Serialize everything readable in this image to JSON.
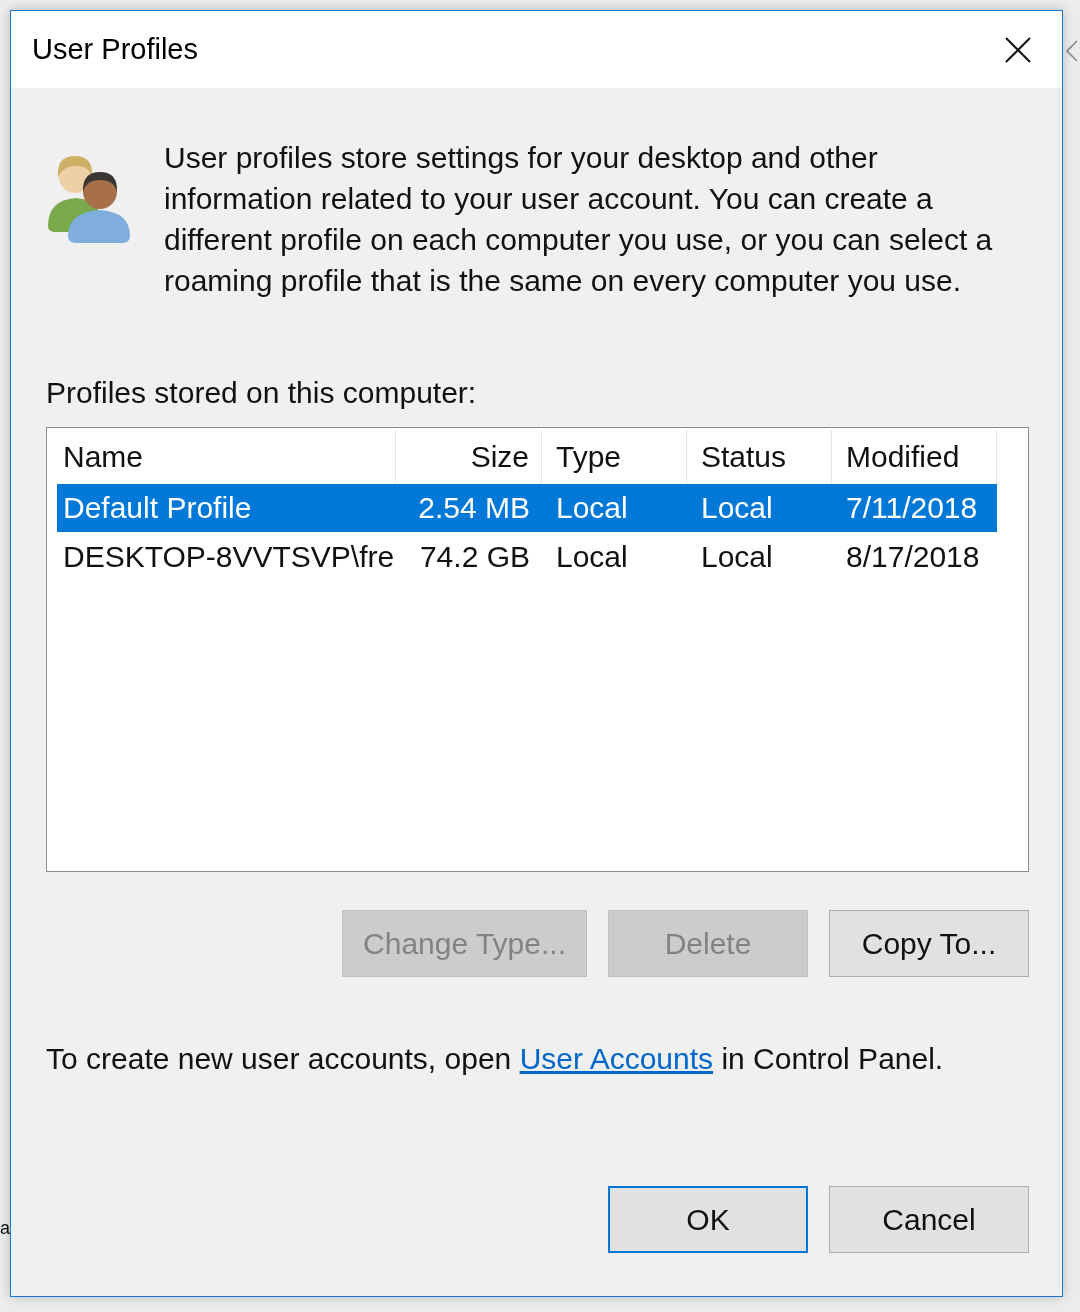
{
  "window": {
    "title": "User Profiles"
  },
  "intro": {
    "text": "User profiles store settings for your desktop and other information related to your user account. You can create a different profile on each computer you use, or you can select a roaming profile that is the same on every computer you use."
  },
  "profiles_label": "Profiles stored on this computer:",
  "table": {
    "columns": [
      {
        "label": "Name",
        "kind": "text"
      },
      {
        "label": "Size",
        "kind": "number"
      },
      {
        "label": "Type",
        "kind": "text"
      },
      {
        "label": "Status",
        "kind": "text"
      },
      {
        "label": "Modified",
        "kind": "text"
      }
    ],
    "rows": [
      {
        "selected": true,
        "cells": [
          "Default Profile",
          "2.54 MB",
          "Local",
          "Local",
          "7/11/2018"
        ]
      },
      {
        "selected": false,
        "cells": [
          "DESKTOP-8VVTSVP\\fre",
          "74.2 GB",
          "Local",
          "Local",
          "8/17/2018"
        ]
      }
    ]
  },
  "action_buttons": [
    {
      "label": "Change Type...",
      "disabled": true
    },
    {
      "label": "Delete",
      "disabled": true
    },
    {
      "label": "Copy To...",
      "disabled": false
    }
  ],
  "footer": {
    "text_before": "To create new user accounts, open",
    "link": "User Accounts",
    "text_after": "in Control Panel."
  },
  "dialog_buttons": [
    {
      "label": "OK",
      "default": true
    },
    {
      "label": "Cancel",
      "default": false
    }
  ],
  "background_window": {
    "text": "a"
  }
}
